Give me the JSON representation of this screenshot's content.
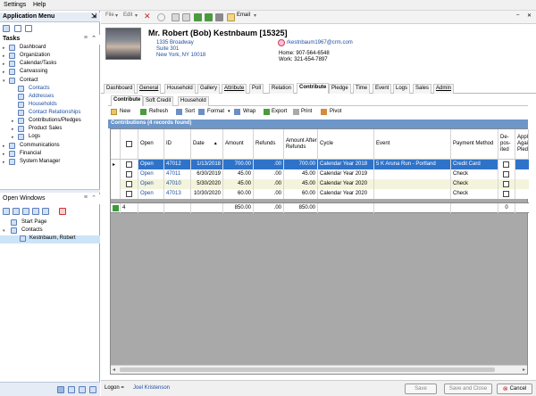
{
  "menubar": {
    "settings": "Settings",
    "help": "Help"
  },
  "app_menu": {
    "title": "Application Menu",
    "tasks_label": "Tasks",
    "items": [
      {
        "label": "Dashboard"
      },
      {
        "label": "Organization"
      },
      {
        "label": "Calendar/Tasks"
      },
      {
        "label": "Canvassing"
      },
      {
        "label": "Contact"
      },
      {
        "label": "Contacts"
      },
      {
        "label": "Addresses"
      },
      {
        "label": "Households"
      },
      {
        "label": "Contact Relationships"
      },
      {
        "label": "Contributions/Pledges"
      },
      {
        "label": "Product Sales"
      },
      {
        "label": "Logs"
      },
      {
        "label": "Communications"
      },
      {
        "label": "Financial"
      },
      {
        "label": "System Manager"
      }
    ]
  },
  "open_windows": {
    "title": "Open Windows",
    "items": [
      {
        "label": "Start Page"
      },
      {
        "label": "Contacts"
      },
      {
        "label": "Kestnbaum, Robert"
      }
    ]
  },
  "toolbar": {
    "file": "File",
    "edit": "Edit",
    "email": "Email"
  },
  "contact": {
    "name": "Mr.  Robert  (Bob)  Kestnbaum  [15325]",
    "address1": "1335 Broadway",
    "address2": "Suite 301",
    "city": "New York, NY 10018",
    "email": "rkestnbaum1967@crm.com",
    "home": "Home: 907-564-6548",
    "work": "Work: 321-654-7897"
  },
  "tabs": [
    {
      "label": "Dashboard"
    },
    {
      "label": "General"
    },
    {
      "label": "Household"
    },
    {
      "label": "Gallery"
    },
    {
      "label": "Attribute"
    },
    {
      "label": "Poll"
    },
    {
      "label": "Relation"
    },
    {
      "label": "Contribute"
    },
    {
      "label": "Pledge"
    },
    {
      "label": "Time"
    },
    {
      "label": "Event"
    },
    {
      "label": "Logs"
    },
    {
      "label": "Sales"
    },
    {
      "label": "Admin"
    }
  ],
  "subtabs": [
    {
      "label": "Contribute"
    },
    {
      "label": "Soft Credit"
    },
    {
      "label": "Household"
    }
  ],
  "grid_toolbar": {
    "new": "New",
    "refresh": "Refresh",
    "sort": "Sort",
    "format": "Format",
    "wrap": "Wrap",
    "export": "Export",
    "print": "Print",
    "pivot": "Pivot"
  },
  "grid": {
    "caption": "Contributions (4 records found)",
    "headers": {
      "open": "Open",
      "id": "ID",
      "date": "Date",
      "amount": "Amount",
      "refunds": "Refunds",
      "after": "Amount After Refunds",
      "cycle": "Cycle",
      "event": "Event",
      "method": "Payment Method",
      "deposited": "De-pos-ited",
      "applied": "Appli Again Pledg"
    },
    "rows": [
      {
        "open": "Open",
        "id": "47012",
        "date": "1/13/2018",
        "amount": "700.00",
        "refunds": ".00",
        "after": "700.00",
        "cycle": "Calendar Year 2018",
        "event": "5 K Aruna Run - Portland",
        "method": "Credit Card"
      },
      {
        "open": "Open",
        "id": "47011",
        "date": "6/30/2019",
        "amount": "45.00",
        "refunds": ".00",
        "after": "45.00",
        "cycle": "Calendar Year 2019",
        "event": "",
        "method": "Check"
      },
      {
        "open": "Open",
        "id": "47010",
        "date": "5/30/2020",
        "amount": "45.00",
        "refunds": ".00",
        "after": "45.00",
        "cycle": "Calendar Year 2020",
        "event": "",
        "method": "Check"
      },
      {
        "open": "Open",
        "id": "47013",
        "date": "10/30/2020",
        "amount": "60.00",
        "refunds": ".00",
        "after": "60.00",
        "cycle": "Calendar Year 2020",
        "event": "",
        "method": "Check"
      }
    ],
    "footer": {
      "count": "4",
      "amount": "850.00",
      "refunds": ".00",
      "after": "850.00",
      "deposited": "0"
    }
  },
  "bottom": {
    "logon_label": "Logon =",
    "logon_user": "Joel Kristenson",
    "save": "Save",
    "save_close": "Save and Close",
    "cancel": "Cancel"
  }
}
